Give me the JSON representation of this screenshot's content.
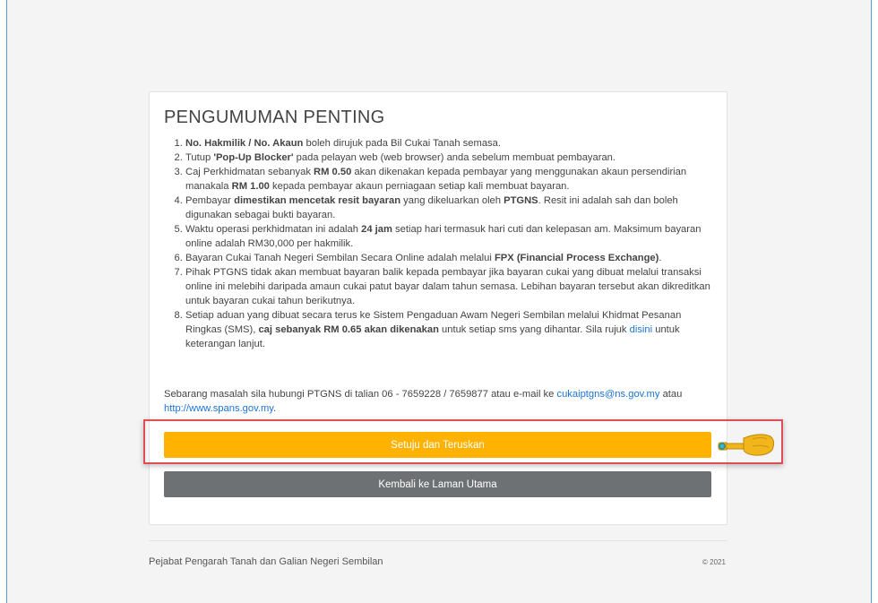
{
  "announcement": {
    "title": "PENGUMUMAN PENTING",
    "items": [
      {
        "segments": [
          {
            "text": "No. Hakmilik / No. Akaun",
            "bold": true
          },
          {
            "text": " boleh dirujuk pada Bil Cukai Tanah semasa.",
            "bold": false
          }
        ]
      },
      {
        "segments": [
          {
            "text": "Tutup ",
            "bold": false
          },
          {
            "text": "'Pop-Up Blocker'",
            "bold": true
          },
          {
            "text": " pada pelayan web (web browser) anda sebelum membuat pembayaran.",
            "bold": false
          }
        ]
      },
      {
        "segments": [
          {
            "text": "Caj Perkhidmatan sebanyak ",
            "bold": false
          },
          {
            "text": "RM 0.50",
            "bold": true
          },
          {
            "text": " akan dikenakan kepada pembayar yang menggunakan akaun persendirian manakala ",
            "bold": false
          },
          {
            "text": "RM 1.00",
            "bold": true
          },
          {
            "text": " kepada pembayar akaun perniagaan setiap kali membuat bayaran.",
            "bold": false
          }
        ]
      },
      {
        "segments": [
          {
            "text": "Pembayar ",
            "bold": false
          },
          {
            "text": "dimestikan mencetak resit bayaran",
            "bold": true
          },
          {
            "text": " yang dikeluarkan oleh ",
            "bold": false
          },
          {
            "text": "PTGNS",
            "bold": true
          },
          {
            "text": ". Resit ini adalah sah dan boleh digunakan sebagai bukti bayaran.",
            "bold": false
          }
        ]
      },
      {
        "segments": [
          {
            "text": "Waktu operasi perkhidmatan ini adalah ",
            "bold": false
          },
          {
            "text": "24 jam",
            "bold": true
          },
          {
            "text": " setiap hari termasuk hari cuti dan kelepasan am. Maksimum bayaran online adalah RM30,000 per hakmilik.",
            "bold": false
          }
        ]
      },
      {
        "segments": [
          {
            "text": "Bayaran Cukai Tanah Negeri Sembilan Secara Online adalah melalui ",
            "bold": false
          },
          {
            "text": "FPX (Financial Process Exchange)",
            "bold": true
          },
          {
            "text": ".",
            "bold": false
          }
        ]
      },
      {
        "segments": [
          {
            "text": "Pihak PTGNS tidak akan membuat bayaran balik kepada pembayar jika bayaran cukai yang dibuat melalui transaksi online ini melebihi daripada amaun cukai patut bayar dalam tahun semasa. Lebihan bayaran tersebut akan dikreditkan untuk bayaran cukai tahun berikutnya.",
            "bold": false
          }
        ]
      },
      {
        "segments": [
          {
            "text": "Setiap aduan yang dibuat secara terus ke Sistem Pengaduan Awam Negeri Sembilan melalui Khidmat Pesanan Ringkas (SMS), ",
            "bold": false
          },
          {
            "text": "caj sebanyak RM 0.65 akan dikenakan",
            "bold": true
          },
          {
            "text": " untuk setiap sms yang dihantar. Sila rujuk ",
            "bold": false
          },
          {
            "text": "disini",
            "link": true
          },
          {
            "text": " untuk keterangan lanjut.",
            "bold": false
          }
        ]
      }
    ]
  },
  "contact": {
    "text_before": "Sebarang masalah sila hubungi PTGNS di talian 06 - 7659228 / 7659877 atau e-mail ke ",
    "email": "cukaiptgns@ns.gov.my",
    "text_mid": " atau ",
    "website": "http://www.spans.gov.my",
    "text_after": "."
  },
  "buttons": {
    "agree_label": "Setuju dan Teruskan",
    "back_label": "Kembali ke Laman Utama"
  },
  "footer": {
    "org": "Pejabat Pengarah Tanah dan Galian Negeri Sembilan",
    "copyright": "© 2021"
  },
  "colors": {
    "agree_button": "#ffb300",
    "back_button": "#6d7174",
    "link": "#1a73d9",
    "highlight_box": "#e04d54",
    "pointer_hand": "#f2b51b"
  },
  "icons": {
    "pointer": "pointing-hand-icon"
  }
}
